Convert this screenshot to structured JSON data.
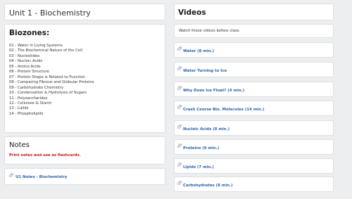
{
  "left": {
    "unit_title": "Unit 1 - Biochemistry",
    "biozones": {
      "heading": "Biozones:",
      "items": [
        "01 - Water in Living Systems",
        "02 - The Biochemical Nature of the Cell",
        "03 - Nucleotides",
        "04 - Nucleic Acids",
        "05 - Amino Acids",
        "06 - Protein Structure",
        "07 - Protein Shape is Related to Function",
        "08 - Comparing Fibrous and Globular Proteins",
        "09 - Carbohydrate Chemistry",
        "10 - Condensation & Hydrolysis of Sugars",
        "11 - Polysaccharides",
        "12 - Cellulose & Starch",
        "13 - Lipids",
        "14 - Phospholipids"
      ]
    },
    "notes": {
      "heading": "Notes",
      "instruction": "Print notes and use as flashcards.",
      "link": "U1 Notes - Biochemistry"
    }
  },
  "right": {
    "heading": "Videos",
    "intro": "Watch these videos before class.",
    "videos": [
      "Water (8 min.)",
      "Water Turning to Ice",
      "Why Does Ice Float? (4 min.)",
      "Crash Course Bio. Molecules (14 min.)",
      "Nucleic Acids (8 min.)",
      "Proteins (9 min.)",
      "Lipids (7 min.)",
      "Carbohydrates (8 min.)"
    ]
  },
  "colors": {
    "background": "#eceeef",
    "card": "#ffffff",
    "link": "#2e62a8",
    "alert": "#c7161b"
  },
  "icons": {
    "attachment": "paperclip-icon"
  }
}
